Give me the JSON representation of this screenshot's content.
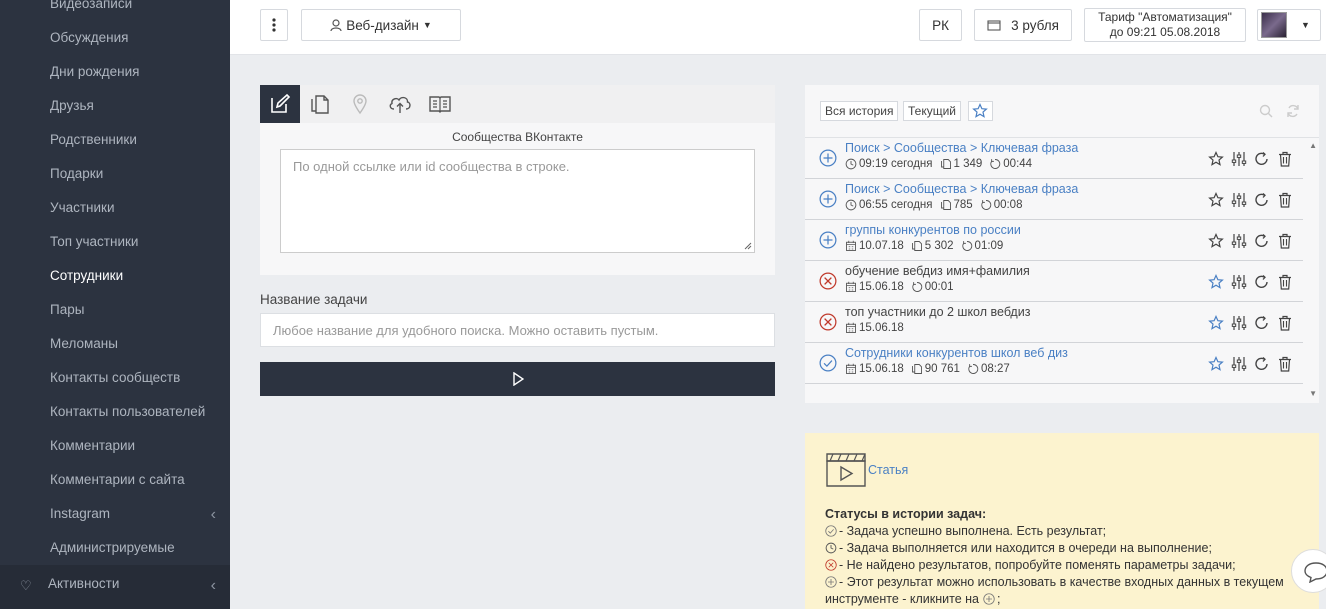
{
  "sidebar": {
    "items": [
      {
        "label": "Видеозаписи"
      },
      {
        "label": "Обсуждения"
      },
      {
        "label": "Дни рождения"
      },
      {
        "label": "Друзья"
      },
      {
        "label": "Родственники"
      },
      {
        "label": "Подарки"
      },
      {
        "label": "Участники"
      },
      {
        "label": "Топ участники"
      },
      {
        "label": "Сотрудники",
        "active": true
      },
      {
        "label": "Пары"
      },
      {
        "label": "Меломаны"
      },
      {
        "label": "Контакты сообществ"
      },
      {
        "label": "Контакты пользователей"
      },
      {
        "label": "Комментарии"
      },
      {
        "label": "Комментарии с сайта"
      },
      {
        "label": "Instagram",
        "has_chevron": true
      },
      {
        "label": "Администрируемые"
      }
    ],
    "bottom": {
      "label": "Активности"
    }
  },
  "topbar": {
    "project": "Веб-дизайн",
    "lang": "РК",
    "balance": "3 рубля",
    "tariff_line1": "Тариф \"Автоматизация\"",
    "tariff_line2": "до 09:21 05.08.2018"
  },
  "form": {
    "source_label": "Сообщества ВКонтакте",
    "source_placeholder": "По одной ссылке или id сообщества в строке.",
    "task_title_label": "Название задачи",
    "task_title_placeholder": "Любое название для удобного поиска. Можно оставить пустым."
  },
  "history": {
    "chip_all": "Вся история",
    "chip_current": "Текущий",
    "rows": [
      {
        "status": "plus",
        "title": "Поиск > Сообщества > Ключевая фраза",
        "link": true,
        "date": "09:19 сегодня",
        "date_icon": "clock",
        "count": "1 349",
        "duration": "00:44",
        "starred": false
      },
      {
        "status": "plus",
        "title": "Поиск > Сообщества > Ключевая фраза",
        "link": true,
        "date": "06:55 сегодня",
        "date_icon": "clock",
        "count": "785",
        "duration": "00:08",
        "starred": false
      },
      {
        "status": "plus",
        "title": "группы конкурентов по россии",
        "link": true,
        "date": "10.07.18",
        "date_icon": "calendar",
        "count": "5 302",
        "duration": "01:09",
        "starred": false
      },
      {
        "status": "error",
        "title": "обучение вебдиз имя+фамилия",
        "link": false,
        "date": "15.06.18",
        "date_icon": "calendar",
        "count": "",
        "duration": "00:01",
        "starred": true
      },
      {
        "status": "error",
        "title": "топ участники до 2 школ вебдиз",
        "link": false,
        "date": "15.06.18",
        "date_icon": "calendar",
        "count": "",
        "duration": "",
        "starred": true
      },
      {
        "status": "done",
        "title": "Сотрудники конкурентов школ веб диз",
        "link": true,
        "date": "15.06.18",
        "date_icon": "calendar",
        "count": "90 761",
        "duration": "08:27",
        "starred": true
      }
    ]
  },
  "info": {
    "article": "Статья",
    "statuses_title": "Статусы в истории задач:",
    "lines": [
      {
        "icon": "done",
        "text": "- Задача успешно выполнена. Есть результат;"
      },
      {
        "icon": "clock",
        "text": "- Задача выполняется или находится в очереди на выполнение;"
      },
      {
        "icon": "error",
        "text": "- Не найдено результатов, попробуйте поменять параметры задачи;"
      },
      {
        "icon": "plus",
        "text": "- Этот результат можно использовать в качестве входных данных в текущем"
      }
    ],
    "last_line_start": "инструменте - кликните на",
    "last_line_end": ";"
  },
  "colors": {
    "sidebar": "#2c3340",
    "accent_link": "#4a80c4",
    "error": "#c0392b",
    "star": "#4a80c4",
    "info_bg": "#fcf3cf"
  }
}
